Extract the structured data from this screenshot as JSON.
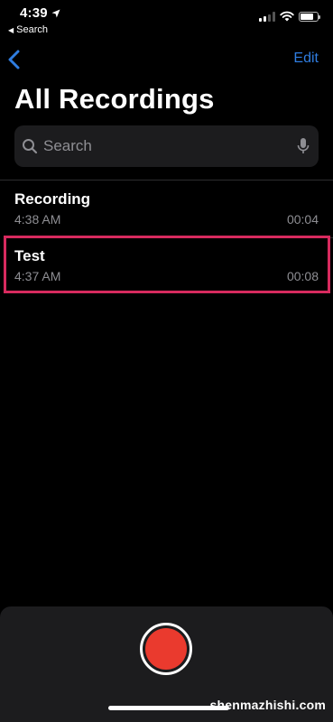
{
  "status_bar": {
    "time": "4:39",
    "back_app_label": "Search",
    "location_icon": "location-arrow-icon",
    "signal_icon": "cellular-signal-icon",
    "wifi_icon": "wifi-icon",
    "battery_icon": "battery-icon"
  },
  "nav": {
    "back_icon": "chevron-left-icon",
    "edit_label": "Edit"
  },
  "page": {
    "title": "All Recordings"
  },
  "search": {
    "placeholder": "Search",
    "value": "",
    "search_icon": "magnifier-icon",
    "mic_icon": "microphone-icon"
  },
  "recordings": [
    {
      "name": "Recording",
      "time": "4:38 AM",
      "duration": "00:04"
    },
    {
      "name": "Test",
      "time": "4:37 AM",
      "duration": "00:08"
    }
  ],
  "record_button": {
    "icon": "record-icon"
  },
  "watermark": "shenmazhishi.com",
  "colors": {
    "accent": "#2f7de1",
    "record_red": "#ea3a2e",
    "highlight_border": "#d72a5e",
    "background": "#000000",
    "surface": "#1c1c1e",
    "secondary_text": "#8e8e93"
  }
}
